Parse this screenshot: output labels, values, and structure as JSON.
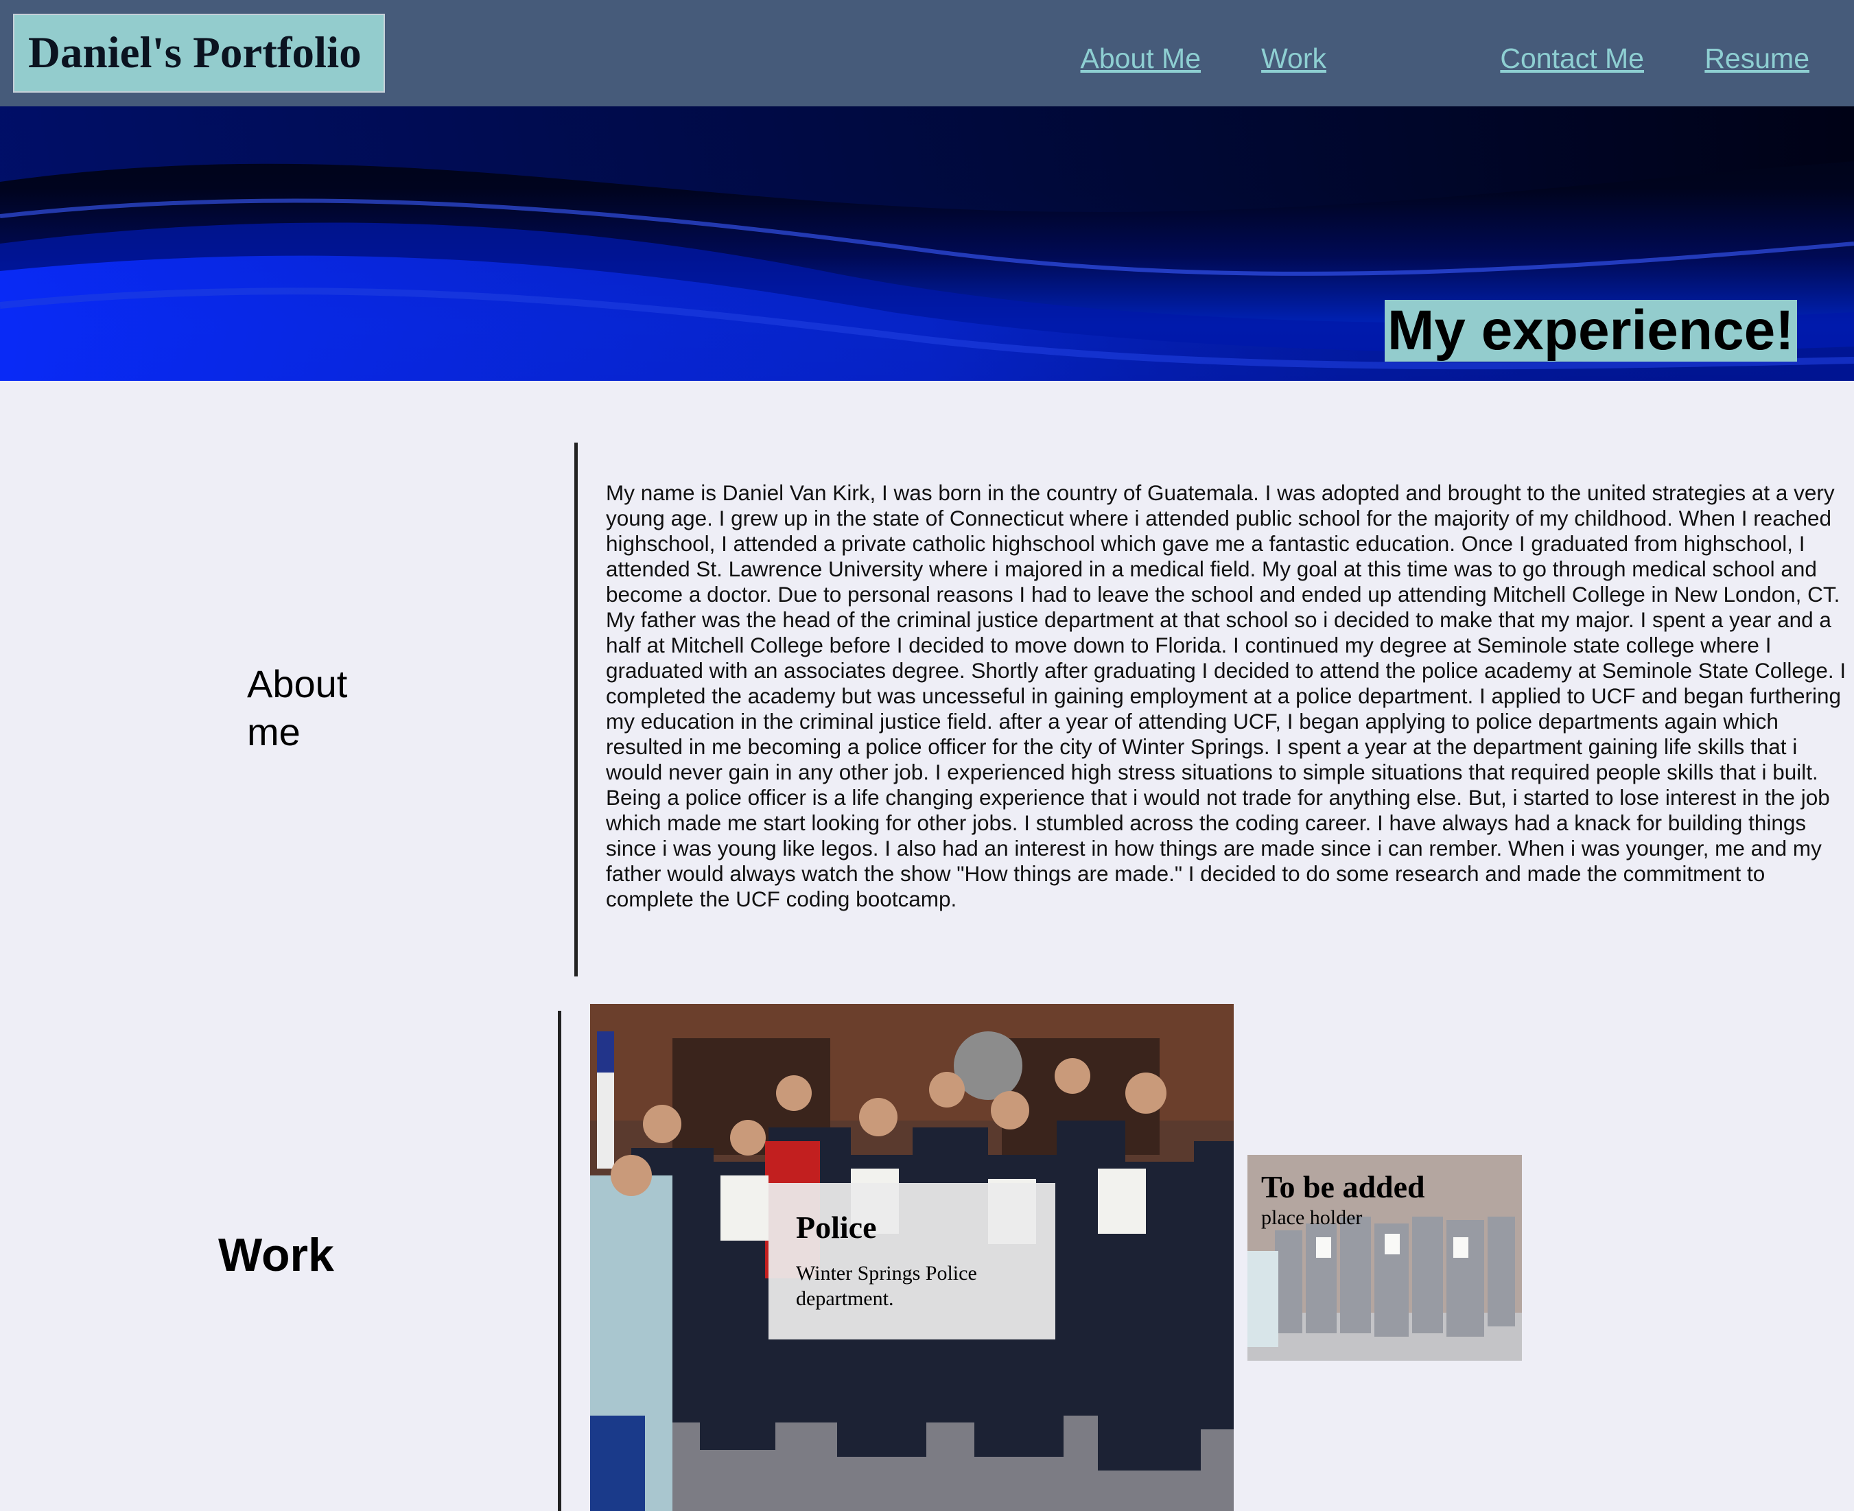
{
  "header": {
    "brand": "Daniel's Portfolio",
    "nav": [
      {
        "label": "About Me"
      },
      {
        "label": "Work"
      },
      {
        "label": "Contact Me"
      },
      {
        "label": "Resume"
      }
    ],
    "background_color": "#465b7a",
    "brand_bg_color": "#93cccd",
    "nav_link_color": "#8ecfd2"
  },
  "hero": {
    "title": "My experience!",
    "image": "blue-wave-banner"
  },
  "about": {
    "heading": "About me",
    "body": "My name is Daniel Van Kirk, I was born in the country of Guatemala. I was adopted and brought to the united strategies at a very young age. I grew up in the state of Connecticut where i attended public school for the majority of my childhood. When I reached highschool, I attended a private catholic highschool which gave me a fantastic education. Once I graduated from highschool, I attended St. Lawrence University where i majored in a medical field. My goal at this time was to go through medical school and become a doctor. Due to personal reasons I had to leave the school and ended up attending Mitchell College in New London, CT. My father was the head of the criminal justice department at that school so i decided to make that my major. I spent a year and a half at Mitchell College before I decided to move down to Florida. I continued my degree at Seminole state college where I graduated with an associates degree. Shortly after graduating I decided to attend the police academy at Seminole State College. I completed the academy but was uncesseful in gaining employment at a police department. I applied to UCF and began furthering my education in the criminal justice field. after a year of attending UCF, I began applying to police departments again which resulted in me becoming a police officer for the city of Winter Springs. I spent a year at the department gaining life skills that i would never gain in any other job. I experienced high stress situations to simple situations that required people skills that i built. Being a police officer is a life changing experience that i would not trade for anything else. But, i started to lose interest in the job which made me start looking for other jobs. I stumbled across the coding career. I have always had a knack for building things since i was young like legos. I also had an interest in how things are made since i can rember. When i was younger, me and my father would always watch the show \"How things are made.\" I decided to do some research and made the commitment to complete the UCF coding bootcamp."
  },
  "work": {
    "heading": "Work",
    "cards": [
      {
        "title": "Police",
        "subtitle": "Winter Springs Police department.",
        "image": "police-group-photo"
      },
      {
        "title": "To be added",
        "subtitle": "place holder",
        "image": "police-group-photo"
      }
    ]
  },
  "colors": {
    "page_bg": "#eeeef6",
    "accent": "#93cccd"
  }
}
